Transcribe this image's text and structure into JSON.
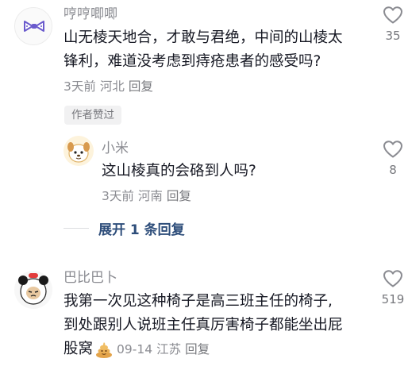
{
  "comments": [
    {
      "username": "哼哼唧唧",
      "lines": [
        "山无棱天地合，才敢与君绝，中间的山棱太",
        "锋利，难道没考虑到痔疮患者的感受吗?"
      ],
      "time": "3天前",
      "location": "河北",
      "reply_label": "回复",
      "likes": "35",
      "badge": "作者赞过",
      "avatar_icon": "bow-tie-icon"
    },
    {
      "username": "小米",
      "lines": [
        "这山棱真的会硌到人吗?"
      ],
      "time": "3天前",
      "location": "河南",
      "reply_label": "回复",
      "likes": "8",
      "avatar_icon": "cartoon-dog-icon"
    },
    {
      "username": "巴比巴卜",
      "lines": [
        "我第一次见这种椅子是高三班主任的椅子,",
        "到处跟别人说班主任真厉害椅子都能坐出屁"
      ],
      "last_line_text": "股窝",
      "time": "09-14",
      "location": "江苏",
      "reply_label": "回复",
      "likes": "519",
      "avatar_icon": "panda-meme-icon",
      "emoji_icon": "poop-emoji-icon"
    }
  ],
  "expand_replies": "展开 1 条回复",
  "colors": {
    "text_primary": "#161823",
    "text_secondary": "#8a8b91",
    "link_blue": "#2d4d7a",
    "badge_bg": "#f1f1f2"
  }
}
